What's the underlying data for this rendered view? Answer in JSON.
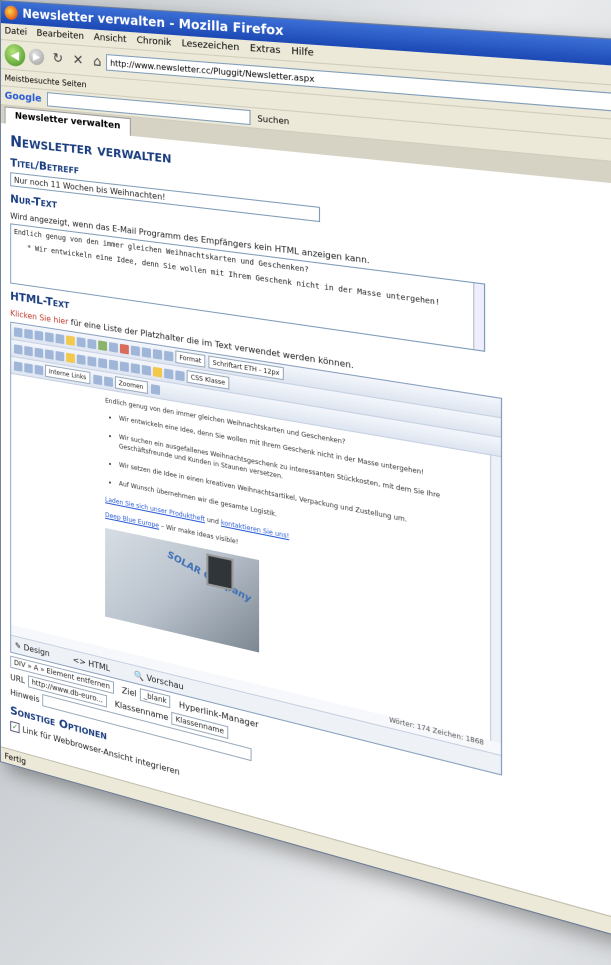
{
  "window": {
    "title": "Newsletter verwalten - Mozilla Firefox"
  },
  "menu": [
    "Datei",
    "Bearbeiten",
    "Ansicht",
    "Chronik",
    "Lesezeichen",
    "Extras",
    "Hilfe"
  ],
  "nav": {
    "url": "http://www.newsletter.cc/Pluggit/Newsletter.aspx"
  },
  "bookmarks": {
    "label": "Meistbesuchte Seiten"
  },
  "google": {
    "label": "Google",
    "suchen": "Suchen"
  },
  "tab": {
    "label": "Newsletter verwalten"
  },
  "page": {
    "title": "Newsletter verwalten",
    "titel_head": "Titel/Betreff",
    "titel_value": "Nur noch 11 Wochen bis Weihnachten!",
    "nurtext_head": "Nur-Text",
    "nurtext_note": "Wird angezeigt, wenn das E-Mail Programm des Empfängers kein HTML anzeigen kann.",
    "nurtext_line1": "Endlich genug von den immer gleichen Weihnachtskarten und Geschenken?",
    "nurtext_line2": "* Wir entwickeln eine Idee, denn Sie wollen mit Ihrem Geschenk nicht in der Masse untergehen!",
    "html_head": "HTML-Text",
    "html_link": "Klicken Sie hier",
    "html_note": " für eine Liste der Platzhalter die im Text verwendet werden können."
  },
  "editor": {
    "font_select": "Format",
    "size_select": "Schriftart ETH - 12px",
    "links_select": "Interne Links",
    "zoom_select": "Zoomen",
    "css_select": "CSS Klasse",
    "intro": "Endlich genug von den immer gleichen Weihnachtskarten und Geschenken?",
    "bullets": [
      "Wir entwickeln eine Idee, denn Sie wollen mit Ihrem Geschenk nicht in der Masse untergehen!",
      "Wir suchen ein ausgefallenes Weihnachtsgeschenk zu interessanten Stückkosten, mit dem Sie Ihre Geschäftsfreunde und Kunden in Staunen versetzen.",
      "Wir setzen die Idee in einen kreativen Weihnachtsartikel, Verpackung und Zustellung um.",
      "Auf Wunsch übernehmen wir die gesamte Logistik."
    ],
    "link_line1_a": "Laden Sie sich unser Produktheft",
    "link_line1_b": " und ",
    "link_line1_c": "kontaktieren Sie uns!",
    "link_line2_a": "Deep Blue Europe",
    "link_line2_b": " – Wir make ideas visible!",
    "image_brand": "SOLAR Company",
    "status": "Wörter: 174  Zeichen: 1868",
    "tab_design": "Design",
    "tab_html": "HTML",
    "tab_vorschau": "Vorschau"
  },
  "attributes": {
    "path": "DIV » A » Element entfernen",
    "ziel_label": "Ziel",
    "ziel_value": "_blank",
    "hyperlink_manager": "Hyperlink-Manager",
    "url_label": "URL",
    "url_value": "http://www.db-euro...",
    "klassenname_label": "Klassenname",
    "klassenname_value": "Klassenname",
    "hinweis_label": "Hinweis"
  },
  "sonstige": {
    "head": "Sonstige Optionen",
    "checkbox_label": "Link für Webbrowser-Ansicht integrieren"
  },
  "statusbar": {
    "text": "Fertig"
  }
}
